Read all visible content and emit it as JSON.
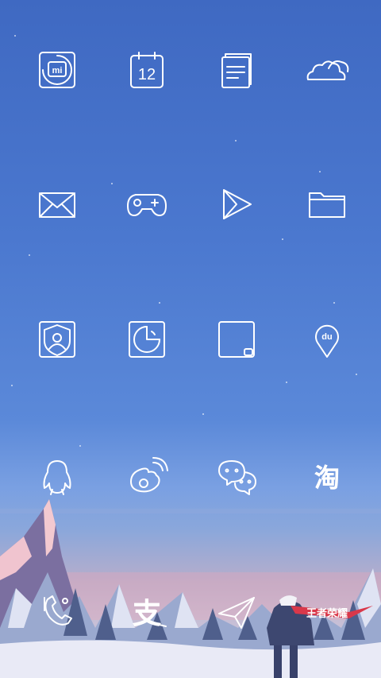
{
  "colors": {
    "sky_top": "#3f69c2",
    "sky_horizon": "#c7bfd6",
    "icon_stroke": "#ffffff",
    "scarf": "#d9384a",
    "snow": "#e9eaf6"
  },
  "home_screen": {
    "rows": [
      [
        {
          "icon": "mi-store-icon",
          "label": "mi"
        },
        {
          "icon": "calendar-icon",
          "label": "12"
        },
        {
          "icon": "notes-icon",
          "label": ""
        },
        {
          "icon": "weather-cloud-icon",
          "label": ""
        }
      ],
      [
        {
          "icon": "mail-icon",
          "label": ""
        },
        {
          "icon": "game-controller-icon",
          "label": ""
        },
        {
          "icon": "video-player-icon",
          "label": ""
        },
        {
          "icon": "folder-icon",
          "label": ""
        }
      ],
      [
        {
          "icon": "security-shield-icon",
          "label": ""
        },
        {
          "icon": "cleaner-icon",
          "label": ""
        },
        {
          "icon": "blank-square-icon",
          "label": ""
        },
        {
          "icon": "baidu-map-pin-icon",
          "label": "du"
        }
      ],
      [
        {
          "icon": "qq-penguin-icon",
          "label": ""
        },
        {
          "icon": "weibo-icon",
          "label": ""
        },
        {
          "icon": "wechat-icon",
          "label": ""
        },
        {
          "icon": "taobao-icon",
          "label": "淘"
        }
      ]
    ],
    "dock": [
      {
        "icon": "phone-icon",
        "label": ""
      },
      {
        "icon": "alipay-icon",
        "label": "支"
      },
      {
        "icon": "paper-plane-icon",
        "label": ""
      },
      {
        "icon": "king-glory-icon",
        "label": "王者荣耀"
      }
    ]
  }
}
